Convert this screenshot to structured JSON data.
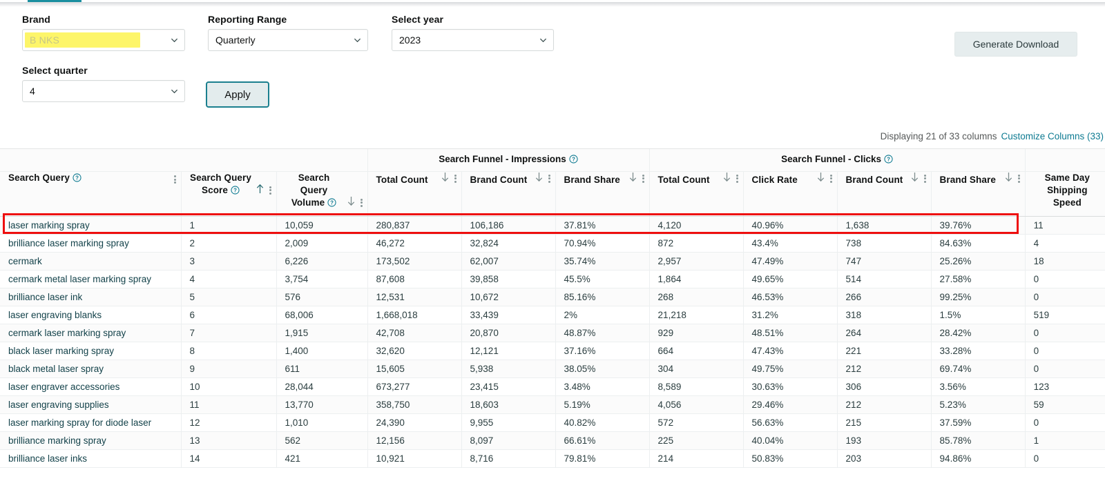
{
  "filters": {
    "brand": {
      "label": "Brand",
      "value": "B                       NKS",
      "redacted": true
    },
    "reporting_range": {
      "label": "Reporting Range",
      "value": "Quarterly"
    },
    "select_year": {
      "label": "Select year",
      "value": "2023"
    },
    "select_quarter": {
      "label": "Select quarter",
      "value": "4"
    },
    "apply_label": "Apply",
    "generate_download_label": "Generate Download"
  },
  "columns_info": {
    "displaying": "Displaying 21 of 33 columns",
    "customize_link": "Customize Columns (33)"
  },
  "groups": [
    {
      "label": "",
      "span": 3
    },
    {
      "label": "Search Funnel - Impressions",
      "span": 3,
      "help": true
    },
    {
      "label": "Search Funnel - Clicks",
      "span": 4,
      "help": true
    },
    {
      "label": "",
      "span": 1
    }
  ],
  "headers": [
    {
      "label": "Search Query",
      "help": true,
      "sort": "none",
      "kebab": true
    },
    {
      "label": "Search Query Score",
      "help": true,
      "sort": "asc",
      "kebab": true
    },
    {
      "label": "Search Query Volume",
      "help": true,
      "sort": "desc",
      "kebab": true
    },
    {
      "label": "Total Count",
      "help": false,
      "sort": "desc",
      "kebab": true
    },
    {
      "label": "Brand Count",
      "help": false,
      "sort": "desc",
      "kebab": true
    },
    {
      "label": "Brand Share",
      "help": false,
      "sort": "desc",
      "kebab": true
    },
    {
      "label": "Total Count",
      "help": false,
      "sort": "desc",
      "kebab": true
    },
    {
      "label": "Click Rate",
      "help": false,
      "sort": "desc",
      "kebab": true
    },
    {
      "label": "Brand Count",
      "help": false,
      "sort": "desc",
      "kebab": true
    },
    {
      "label": "Brand Share",
      "help": false,
      "sort": "desc",
      "kebab": true
    },
    {
      "label": "Same Day Shipping Speed",
      "help": false,
      "sort": "none",
      "kebab": false
    }
  ],
  "rows": [
    [
      "laser marking spray",
      "1",
      "10,059",
      "280,837",
      "106,186",
      "37.81%",
      "4,120",
      "40.96%",
      "1,638",
      "39.76%",
      "11"
    ],
    [
      "brilliance laser marking spray",
      "2",
      "2,009",
      "46,272",
      "32,824",
      "70.94%",
      "872",
      "43.4%",
      "738",
      "84.63%",
      "4"
    ],
    [
      "cermark",
      "3",
      "6,226",
      "173,502",
      "62,007",
      "35.74%",
      "2,957",
      "47.49%",
      "747",
      "25.26%",
      "18"
    ],
    [
      "cermark metal laser marking spray",
      "4",
      "3,754",
      "87,608",
      "39,858",
      "45.5%",
      "1,864",
      "49.65%",
      "514",
      "27.58%",
      "0"
    ],
    [
      "brilliance laser ink",
      "5",
      "576",
      "12,531",
      "10,672",
      "85.16%",
      "268",
      "46.53%",
      "266",
      "99.25%",
      "0"
    ],
    [
      "laser engraving blanks",
      "6",
      "68,006",
      "1,668,018",
      "33,439",
      "2%",
      "21,218",
      "31.2%",
      "318",
      "1.5%",
      "519"
    ],
    [
      "cermark laser marking spray",
      "7",
      "1,915",
      "42,708",
      "20,870",
      "48.87%",
      "929",
      "48.51%",
      "264",
      "28.42%",
      "0"
    ],
    [
      "black laser marking spray",
      "8",
      "1,400",
      "32,620",
      "12,121",
      "37.16%",
      "664",
      "47.43%",
      "221",
      "33.28%",
      "0"
    ],
    [
      "black metal laser spray",
      "9",
      "611",
      "15,605",
      "5,938",
      "38.05%",
      "304",
      "49.75%",
      "212",
      "69.74%",
      "0"
    ],
    [
      "laser engraver accessories",
      "10",
      "28,044",
      "673,277",
      "23,415",
      "3.48%",
      "8,589",
      "30.63%",
      "306",
      "3.56%",
      "123"
    ],
    [
      "laser engraving supplies",
      "11",
      "13,770",
      "358,750",
      "18,603",
      "5.19%",
      "4,056",
      "29.46%",
      "212",
      "5.23%",
      "59"
    ],
    [
      "laser marking spray for diode laser",
      "12",
      "1,010",
      "24,390",
      "9,955",
      "40.82%",
      "572",
      "56.63%",
      "215",
      "37.59%",
      "0"
    ],
    [
      "brilliance marking spray",
      "13",
      "562",
      "12,156",
      "8,097",
      "66.61%",
      "225",
      "40.04%",
      "193",
      "85.78%",
      "1"
    ],
    [
      "brilliance laser inks",
      "14",
      "421",
      "10,921",
      "8,716",
      "79.81%",
      "214",
      "50.83%",
      "203",
      "94.86%",
      "0"
    ]
  ],
  "highlighted_row_index": 0,
  "colors": {
    "accent_teal": "#1a7f8e",
    "link": "#0d7a91",
    "highlight_red": "#ee0e0e",
    "redact_yellow": "#fdf569"
  }
}
